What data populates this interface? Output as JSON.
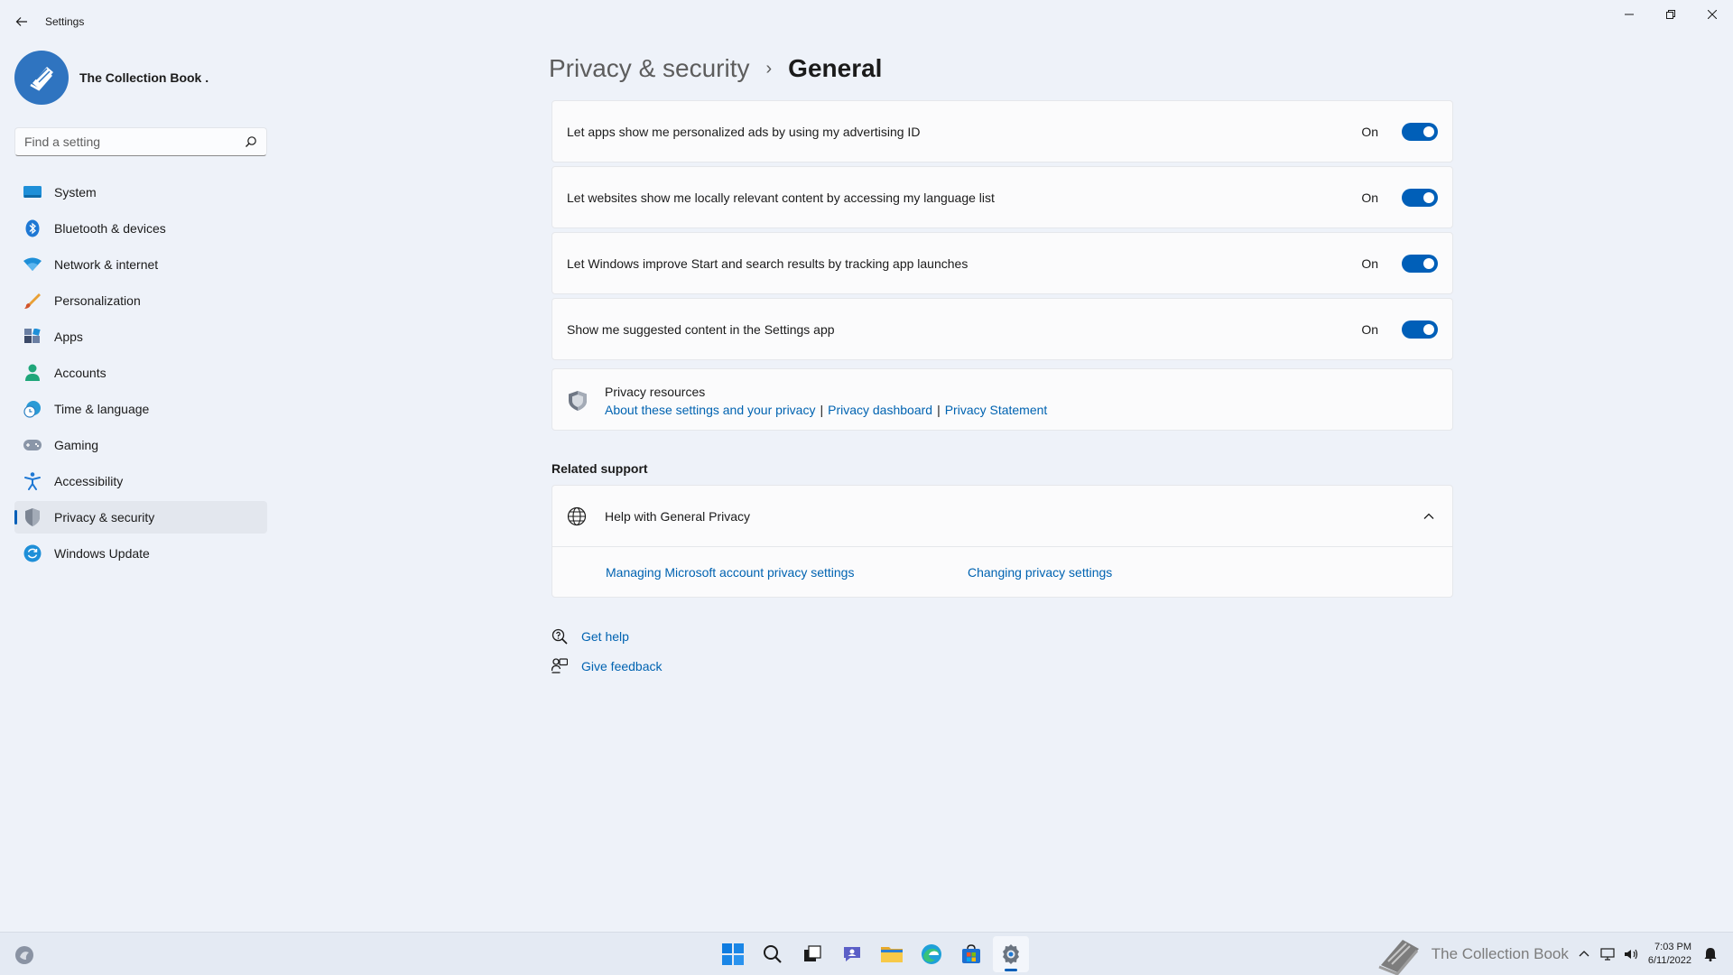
{
  "window": {
    "title": "Settings"
  },
  "profile": {
    "name": "The Collection Book ."
  },
  "search": {
    "placeholder": "Find a setting"
  },
  "sidebar": {
    "items": [
      {
        "label": "System",
        "icon": "monitor-icon"
      },
      {
        "label": "Bluetooth & devices",
        "icon": "bluetooth-icon"
      },
      {
        "label": "Network & internet",
        "icon": "wifi-icon"
      },
      {
        "label": "Personalization",
        "icon": "brush-icon"
      },
      {
        "label": "Apps",
        "icon": "apps-icon"
      },
      {
        "label": "Accounts",
        "icon": "person-icon"
      },
      {
        "label": "Time & language",
        "icon": "globe-clock-icon"
      },
      {
        "label": "Gaming",
        "icon": "gamepad-icon"
      },
      {
        "label": "Accessibility",
        "icon": "accessibility-icon"
      },
      {
        "label": "Privacy & security",
        "icon": "shield-icon",
        "active": true
      },
      {
        "label": "Windows Update",
        "icon": "update-icon"
      }
    ]
  },
  "breadcrumb": {
    "parent": "Privacy & security",
    "separator": "›",
    "current": "General"
  },
  "settings": [
    {
      "label": "Let apps show me personalized ads by using my advertising ID",
      "state": "On",
      "on": true
    },
    {
      "label": "Let websites show me locally relevant content by accessing my language list",
      "state": "On",
      "on": true
    },
    {
      "label": "Let Windows improve Start and search results by tracking app launches",
      "state": "On",
      "on": true
    },
    {
      "label": "Show me suggested content in the Settings app",
      "state": "On",
      "on": true
    }
  ],
  "resources": {
    "title": "Privacy resources",
    "links": [
      "About these settings and your privacy",
      "Privacy dashboard",
      "Privacy Statement"
    ],
    "separator": "|"
  },
  "related_support": {
    "title": "Related support",
    "help_title": "Help with General Privacy",
    "links": [
      "Managing Microsoft account privacy settings",
      "Changing privacy settings"
    ]
  },
  "help": {
    "get_help": "Get help",
    "give_feedback": "Give feedback"
  },
  "taskbar": {
    "apps": [
      "start-icon",
      "search-icon",
      "task-view-icon",
      "chat-icon",
      "file-explorer-icon",
      "edge-icon",
      "store-icon",
      "settings-icon"
    ],
    "watermark": "The Collection Book",
    "time": "7:03 PM",
    "date": "6/11/2022"
  },
  "colors": {
    "accent": "#005fb8",
    "link": "#0063b1",
    "background": "#eef2f9"
  }
}
